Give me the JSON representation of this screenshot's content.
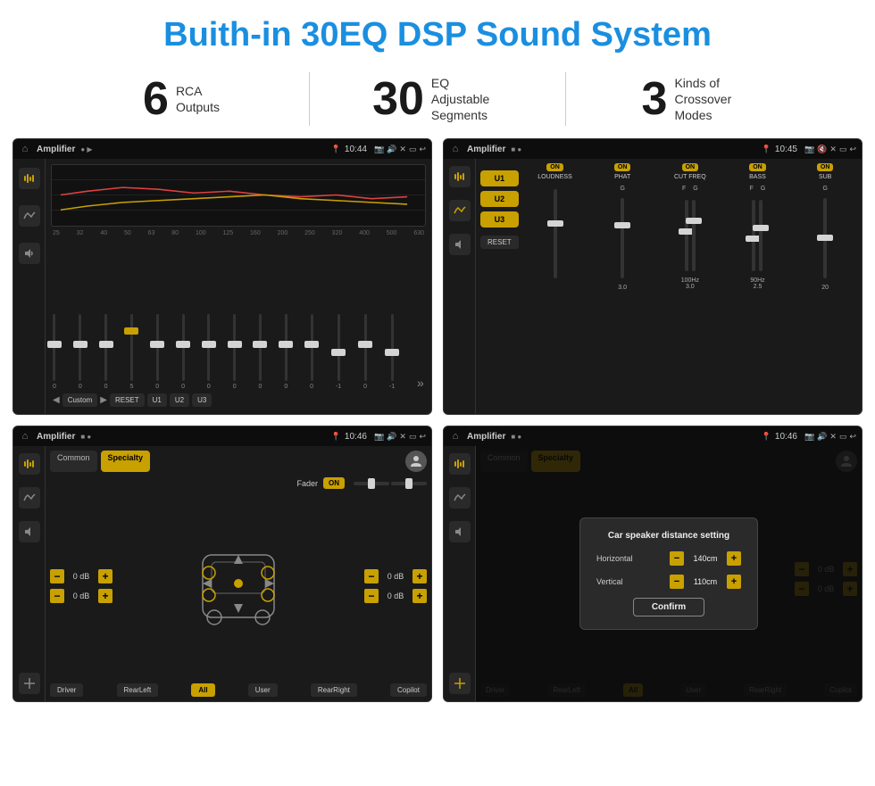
{
  "header": {
    "title": "Buith-in 30EQ DSP Sound System"
  },
  "stats": [
    {
      "number": "6",
      "label": "RCA\nOutputs"
    },
    {
      "number": "30",
      "label": "EQ Adjustable\nSegments"
    },
    {
      "number": "3",
      "label": "Kinds of\nCrossover Modes"
    }
  ],
  "screens": {
    "eq": {
      "title": "Amplifier",
      "time": "10:44",
      "frequencies": [
        "25",
        "32",
        "40",
        "50",
        "63",
        "80",
        "100",
        "125",
        "160",
        "200",
        "250",
        "320",
        "400",
        "500",
        "630"
      ],
      "values": [
        "0",
        "0",
        "0",
        "5",
        "0",
        "0",
        "0",
        "0",
        "0",
        "0",
        "0",
        "-1",
        "0",
        "-1"
      ],
      "buttons": [
        "Custom",
        "RESET",
        "U1",
        "U2",
        "U3"
      ]
    },
    "crossover": {
      "title": "Amplifier",
      "time": "10:45",
      "u_buttons": [
        "U1",
        "U2",
        "U3"
      ],
      "controls": [
        {
          "name": "LOUDNESS",
          "on": true
        },
        {
          "name": "PHAT",
          "on": true
        },
        {
          "name": "CUT FREQ",
          "on": true
        },
        {
          "name": "BASS",
          "on": true
        },
        {
          "name": "SUB",
          "on": true
        }
      ],
      "reset_label": "RESET"
    },
    "fader": {
      "title": "Amplifier",
      "time": "10:46",
      "tabs": [
        "Common",
        "Specialty"
      ],
      "active_tab": "Specialty",
      "fader_label": "Fader",
      "fader_on": "ON",
      "volumes": [
        "0 dB",
        "0 dB",
        "0 dB",
        "0 dB"
      ],
      "buttons": [
        "Driver",
        "RearLeft",
        "All",
        "User",
        "RearRight",
        "Copilot"
      ]
    },
    "dialog": {
      "title": "Amplifier",
      "time": "10:46",
      "tabs": [
        "Common",
        "Specialty"
      ],
      "dialog_title": "Car speaker distance setting",
      "horizontal_label": "Horizontal",
      "horizontal_value": "140cm",
      "vertical_label": "Vertical",
      "vertical_value": "110cm",
      "confirm_label": "Confirm",
      "volumes_right": [
        "0 dB",
        "0 dB"
      ],
      "buttons": [
        "Driver",
        "RearLeft",
        "All",
        "User",
        "RearRight",
        "Copilot"
      ]
    }
  }
}
